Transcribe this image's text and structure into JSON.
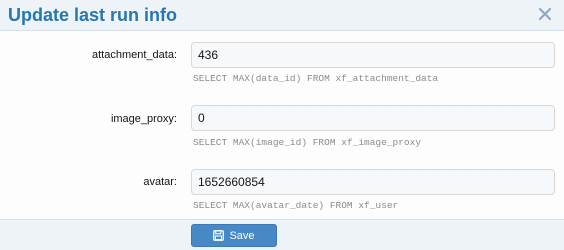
{
  "overlay": {
    "title": "Update last run info",
    "close_icon": "close-icon"
  },
  "colors": {
    "title_text": "#2577b1",
    "header_bg": "#eef3f8",
    "button_bg": "#4788c7",
    "hint_text": "#8c8c8c"
  },
  "form": {
    "rows": [
      {
        "label": "attachment_data:",
        "value": "436",
        "hint": "SELECT MAX(data_id) FROM xf_attachment_data"
      },
      {
        "label": "image_proxy:",
        "value": "0",
        "hint": "SELECT MAX(image_id) FROM xf_image_proxy"
      },
      {
        "label": "avatar:",
        "value": "1652660854",
        "hint": "SELECT MAX(avatar_date) FROM xf_user"
      }
    ]
  },
  "footer": {
    "save_label": "Save",
    "save_icon": "save-icon"
  }
}
